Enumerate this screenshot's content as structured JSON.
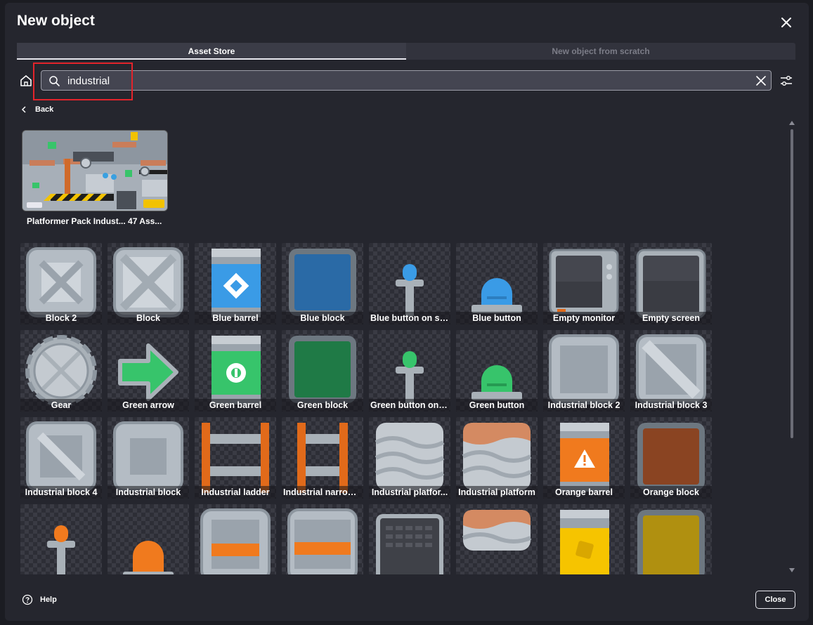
{
  "dialog": {
    "title": "New object"
  },
  "tabs": [
    {
      "label": "Asset Store",
      "active": true
    },
    {
      "label": "New object from scratch",
      "active": false
    }
  ],
  "search": {
    "value": "industrial",
    "placeholder": ""
  },
  "navigation": {
    "back_label": "Back"
  },
  "pack": {
    "label": "Platformer Pack Indust... 47 Ass..."
  },
  "assets": [
    {
      "label": "Block 2",
      "icon": "block-2"
    },
    {
      "label": "Block",
      "icon": "block"
    },
    {
      "label": "Blue barrel",
      "icon": "blue-barrel"
    },
    {
      "label": "Blue block",
      "icon": "blue-block"
    },
    {
      "label": "Blue button on so...",
      "icon": "blue-button-on-stand"
    },
    {
      "label": "Blue button",
      "icon": "blue-button"
    },
    {
      "label": "Empty monitor",
      "icon": "empty-monitor"
    },
    {
      "label": "Empty screen",
      "icon": "empty-screen"
    },
    {
      "label": "Gear",
      "icon": "gear"
    },
    {
      "label": "Green arrow",
      "icon": "green-arrow"
    },
    {
      "label": "Green barrel",
      "icon": "green-barrel"
    },
    {
      "label": "Green block",
      "icon": "green-block"
    },
    {
      "label": "Green button on s...",
      "icon": "green-button-on-stand"
    },
    {
      "label": "Green button",
      "icon": "green-button"
    },
    {
      "label": "Industrial block 2",
      "icon": "industrial-block-2"
    },
    {
      "label": "Industrial block 3",
      "icon": "industrial-block-3"
    },
    {
      "label": "Industrial block 4",
      "icon": "industrial-block-4"
    },
    {
      "label": "Industrial block",
      "icon": "industrial-block"
    },
    {
      "label": "Industrial ladder",
      "icon": "industrial-ladder"
    },
    {
      "label": "Industrial narrow ...",
      "icon": "industrial-narrow-ladder"
    },
    {
      "label": "Industrial platfor...",
      "icon": "industrial-platform-wave"
    },
    {
      "label": "Industrial platform",
      "icon": "industrial-platform"
    },
    {
      "label": "Orange barrel",
      "icon": "orange-barrel"
    },
    {
      "label": "Orange block",
      "icon": "orange-block"
    },
    {
      "label": "",
      "icon": "orange-button-on-stand"
    },
    {
      "label": "",
      "icon": "orange-button"
    },
    {
      "label": "",
      "icon": "block-orange-stripe"
    },
    {
      "label": "",
      "icon": "block-orange-stripe-2"
    },
    {
      "label": "",
      "icon": "dark-panel"
    },
    {
      "label": "",
      "icon": "platform-small"
    },
    {
      "label": "",
      "icon": "yellow-barrel"
    },
    {
      "label": "",
      "icon": "yellow-block"
    }
  ],
  "footer": {
    "help_label": "Help",
    "close_label": "Close"
  },
  "colors": {
    "accent": "#e8e8ef",
    "highlight": "#e3242b",
    "background": "#25262e"
  }
}
